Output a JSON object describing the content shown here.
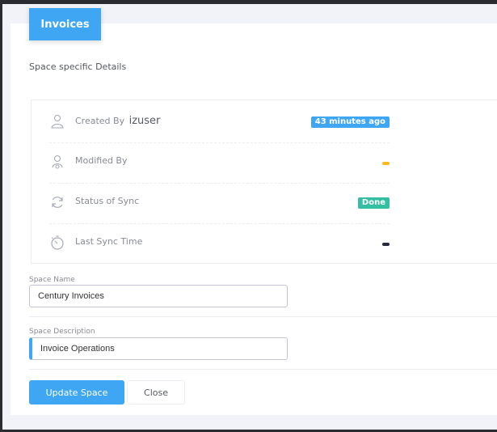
{
  "header": {
    "tab_label": "Invoices",
    "subtitle": "Space specific Details"
  },
  "details": {
    "created_by": {
      "label": "Created By",
      "user": "izuser",
      "badge": "43 minutes ago"
    },
    "modified_by": {
      "label": "Modified By"
    },
    "status_of_sync": {
      "label": "Status of Sync",
      "badge": "Done"
    },
    "last_sync_time": {
      "label": "Last Sync Time"
    }
  },
  "form": {
    "space_name": {
      "label": "Space Name",
      "value": "Century Invoices"
    },
    "space_description": {
      "label": "Space Description",
      "value": "Invoice Operations"
    }
  },
  "buttons": {
    "update": "Update Space",
    "close": "Close"
  },
  "colors": {
    "primary": "#3ea6f2",
    "success": "#34bfa3",
    "warning": "#ffb822",
    "dark": "#282a3c"
  },
  "icons": {
    "created_by": "user-outline-icon",
    "modified_by": "user-edit-icon",
    "status_of_sync": "sync-icon",
    "last_sync_time": "stopwatch-icon"
  }
}
